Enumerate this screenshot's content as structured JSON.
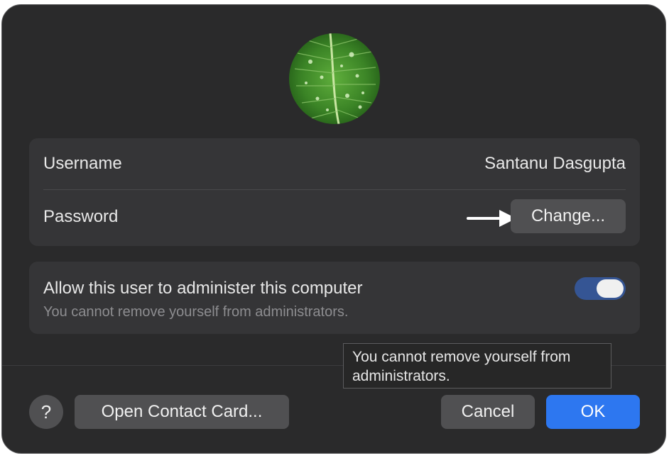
{
  "avatar": {
    "icon": "leaf-photo"
  },
  "account": {
    "username_label": "Username",
    "username_value": "Santanu Dasgupta",
    "password_label": "Password",
    "change_button": "Change..."
  },
  "admin": {
    "title": "Allow this user to administer this computer",
    "subtitle": "You cannot remove yourself from administrators.",
    "toggle_on": true
  },
  "tooltip": {
    "text": "You cannot remove yourself from administrators."
  },
  "footer": {
    "help_label": "?",
    "contact_card_button": "Open Contact Card...",
    "cancel_button": "Cancel",
    "ok_button": "OK"
  },
  "colors": {
    "accent": "#2d77f0",
    "toggle_track": "#355594",
    "dialog_bg": "#2a2a2b"
  }
}
